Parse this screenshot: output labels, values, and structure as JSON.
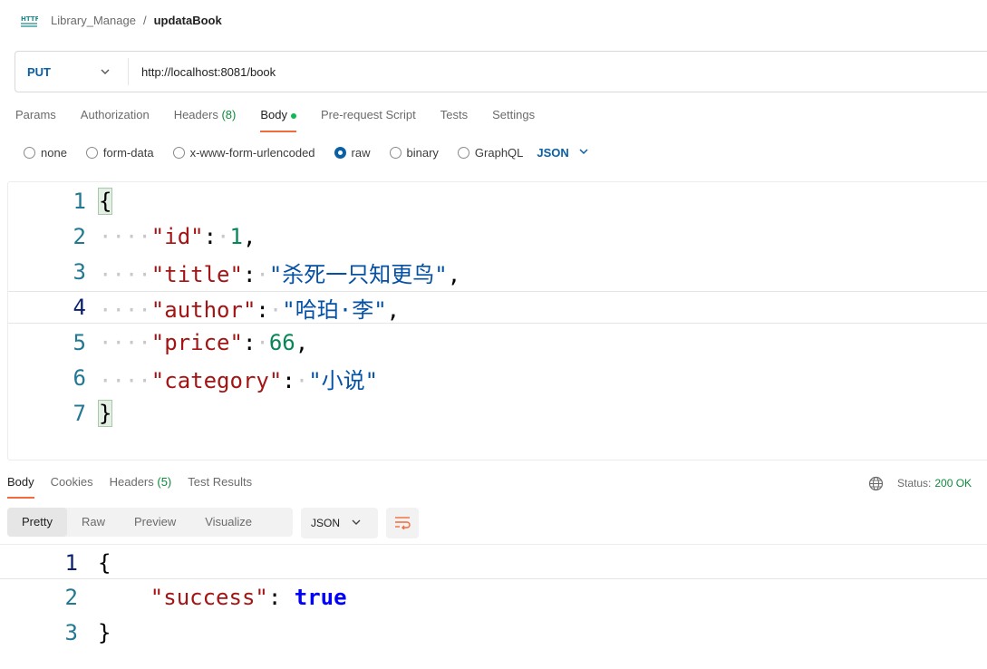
{
  "breadcrumb": {
    "parent": "Library_Manage",
    "separator": "/",
    "current": "updataBook"
  },
  "request": {
    "method": "PUT",
    "url": "http://localhost:8081/book"
  },
  "request_tabs": [
    {
      "label": "Params"
    },
    {
      "label": "Authorization"
    },
    {
      "label": "Headers",
      "count": "(8)"
    },
    {
      "label": "Body"
    },
    {
      "label": "Pre-request Script"
    },
    {
      "label": "Tests"
    },
    {
      "label": "Settings"
    }
  ],
  "body_types": [
    "none",
    "form-data",
    "x-www-form-urlencoded",
    "raw",
    "binary",
    "GraphQL"
  ],
  "body_format": "JSON",
  "request_body": {
    "line_numbers": [
      "1",
      "2",
      "3",
      "4",
      "5",
      "6",
      "7"
    ],
    "open_brace": "{",
    "close_brace": "}",
    "id_key": "\"id\"",
    "id_value": "1",
    "title_key": "\"title\"",
    "title_value": "\"杀死一只知更鸟\"",
    "author_key": "\"author\"",
    "author_value": "\"哈珀·李\"",
    "price_key": "\"price\"",
    "price_value": "66",
    "category_key": "\"category\"",
    "category_value": "\"小说\""
  },
  "response_tabs": [
    {
      "label": "Body"
    },
    {
      "label": "Cookies"
    },
    {
      "label": "Headers",
      "count": "(5)"
    },
    {
      "label": "Test Results"
    }
  ],
  "status": {
    "label": "Status:",
    "code": "200 OK"
  },
  "view_modes": [
    "Pretty",
    "Raw",
    "Preview",
    "Visualize"
  ],
  "response_format": "JSON",
  "response_body": {
    "line_numbers": [
      "1",
      "2",
      "3"
    ],
    "open_brace": "{",
    "close_brace": "}",
    "success_key": "\"success\"",
    "success_value": "true"
  },
  "colors": {
    "accent_tab": "#f26b3a",
    "method_blue": "#0b5fa5",
    "status_green": "#0c8a3a"
  }
}
